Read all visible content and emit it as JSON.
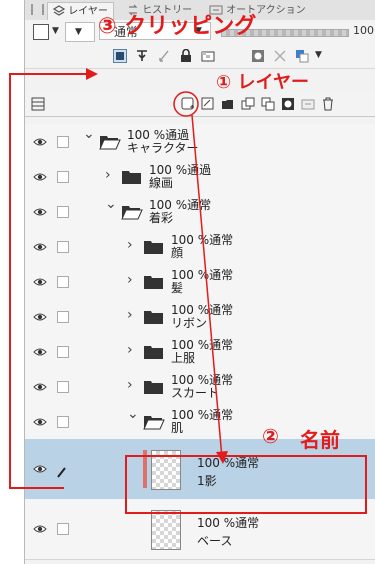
{
  "tabs": [
    {
      "label": "レイヤー",
      "active": true
    },
    {
      "label": "ヒストリー",
      "active": false
    },
    {
      "label": "オートアクション",
      "active": false
    }
  ],
  "properties": {
    "blend_mode": "通常",
    "opacity": "100"
  },
  "layer_toolbar_icons": [
    "new-raster-layer-icon",
    "new-vector-layer-icon",
    "new-folder-icon",
    "copy-layer-icon",
    "merge-icon",
    "mask-icon",
    "transfer-icon",
    "delete-icon"
  ],
  "property_icons": [
    "clip-to-lower-icon",
    "reference-layer-icon",
    "draft-layer-icon",
    "lock-icon",
    "lock-transparent-icon",
    "mask-enable-icon",
    "ruler-icon",
    "layer-color-icon"
  ],
  "layers": [
    {
      "pct": "100 %通過",
      "name": "キャラクター",
      "type": "folder",
      "open": true,
      "indent": 0
    },
    {
      "pct": "100 %通過",
      "name": "線画",
      "type": "folder",
      "open": false,
      "indent": 1
    },
    {
      "pct": "100 %通常",
      "name": "着彩",
      "type": "folder",
      "open": true,
      "indent": 1
    },
    {
      "pct": "100 %通常",
      "name": "顔",
      "type": "folder",
      "open": false,
      "indent": 2
    },
    {
      "pct": "100 %通常",
      "name": "髪",
      "type": "folder",
      "open": false,
      "indent": 2
    },
    {
      "pct": "100 %通常",
      "name": "リボン",
      "type": "folder",
      "open": false,
      "indent": 2
    },
    {
      "pct": "100 %通常",
      "name": "上服",
      "type": "folder",
      "open": false,
      "indent": 2
    },
    {
      "pct": "100 %通常",
      "name": "スカート",
      "type": "folder",
      "open": false,
      "indent": 2
    },
    {
      "pct": "100 %通常",
      "name": "肌",
      "type": "folder",
      "open": true,
      "indent": 2
    },
    {
      "pct": "100 %通常",
      "name": "1影",
      "type": "layer",
      "selected": true,
      "clipped": true
    },
    {
      "pct": "100 %通常",
      "name": "ベース",
      "type": "layer",
      "selected": false,
      "clipped": false
    }
  ],
  "annotations": {
    "a3": "③ クリッピング",
    "a1": "① レイヤー",
    "a2_num": "②",
    "a2_text": "名前"
  },
  "colors": {
    "annotation_red": "#e21c1c",
    "selection": "#b9d2e6",
    "clip_bar": "#e0706a"
  }
}
